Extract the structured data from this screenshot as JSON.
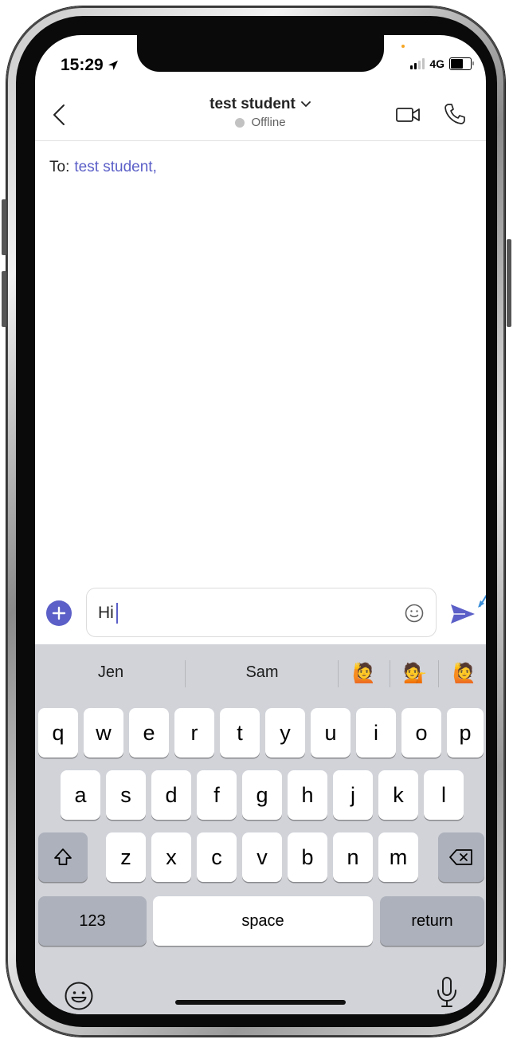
{
  "status_bar": {
    "time": "15:29",
    "network": "4G"
  },
  "header": {
    "title": "test student",
    "presence": "Offline"
  },
  "to_line": {
    "label": "To:",
    "recipient": "test student,"
  },
  "compose": {
    "value": "Hi"
  },
  "colors": {
    "accent": "#5b5fc7",
    "keyboard_bg": "#d1d3d9",
    "hint_arrow": "#3b8fd9"
  },
  "suggestions": {
    "words": [
      "Jen",
      "Sam"
    ],
    "emojis": [
      "🙋",
      "💁",
      "🙋"
    ]
  },
  "keyboard": {
    "row1": [
      "q",
      "w",
      "e",
      "r",
      "t",
      "y",
      "u",
      "i",
      "o",
      "p"
    ],
    "row2": [
      "a",
      "s",
      "d",
      "f",
      "g",
      "h",
      "j",
      "k",
      "l"
    ],
    "row3": [
      "z",
      "x",
      "c",
      "v",
      "b",
      "n",
      "m"
    ],
    "numbers_label": "123",
    "space_label": "space",
    "return_label": "return"
  },
  "icons": {
    "back": "chevron-left-icon",
    "dropdown": "chevron-down-icon",
    "video": "video-camera-icon",
    "call": "phone-icon",
    "add": "plus-icon",
    "emoji": "smiley-icon",
    "send": "send-icon",
    "shift": "shift-icon",
    "delete": "backspace-icon",
    "mic": "microphone-icon"
  }
}
